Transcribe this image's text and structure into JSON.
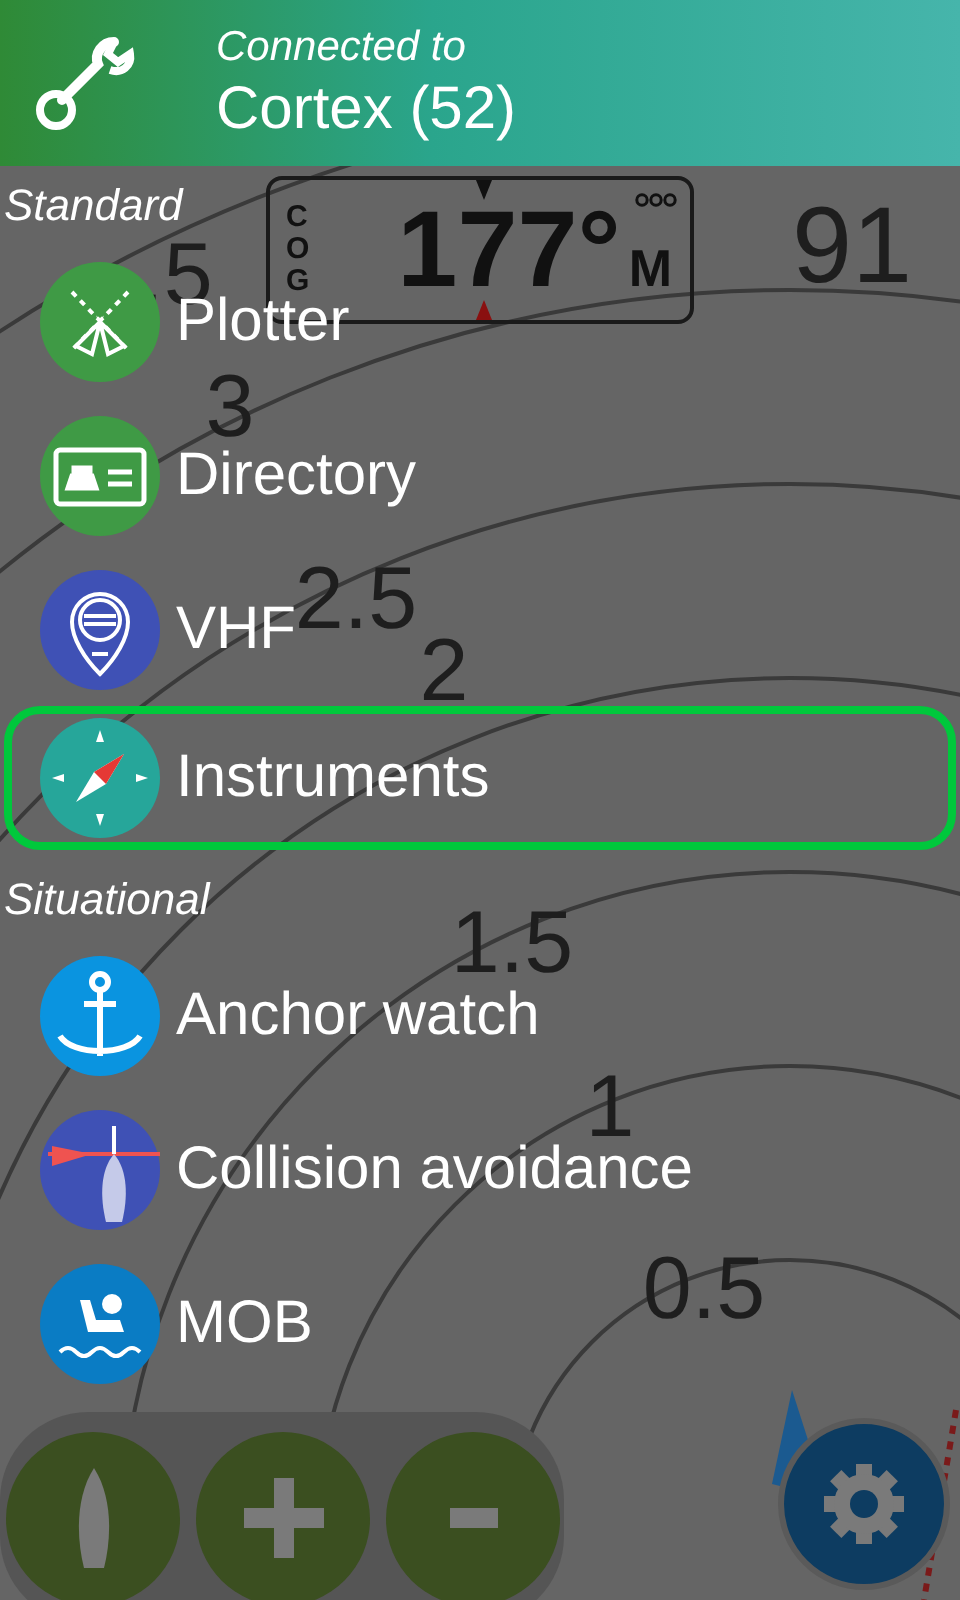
{
  "header": {
    "caption": "Connected to",
    "device": "Cortex (52)"
  },
  "map": {
    "range_labels": [
      ".5",
      "3",
      "2.5",
      "2",
      "1.5",
      "1",
      "0.5"
    ],
    "side_value": "91",
    "cog": {
      "letters": [
        "C",
        "O",
        "G"
      ],
      "value": "177°",
      "unit": "M"
    }
  },
  "sections": [
    {
      "title": "Standard",
      "items": [
        {
          "label": "Plotter",
          "kind": "plotter",
          "selected": false
        },
        {
          "label": "Directory",
          "kind": "directory",
          "selected": false
        },
        {
          "label": "VHF",
          "kind": "vhf",
          "selected": false
        },
        {
          "label": "Instruments",
          "kind": "instruments",
          "selected": true
        }
      ]
    },
    {
      "title": "Situational",
      "items": [
        {
          "label": "Anchor watch",
          "kind": "anchor",
          "selected": false
        },
        {
          "label": "Collision avoidance",
          "kind": "collision",
          "selected": false
        },
        {
          "label": "MOB",
          "kind": "mob",
          "selected": false
        }
      ]
    }
  ]
}
